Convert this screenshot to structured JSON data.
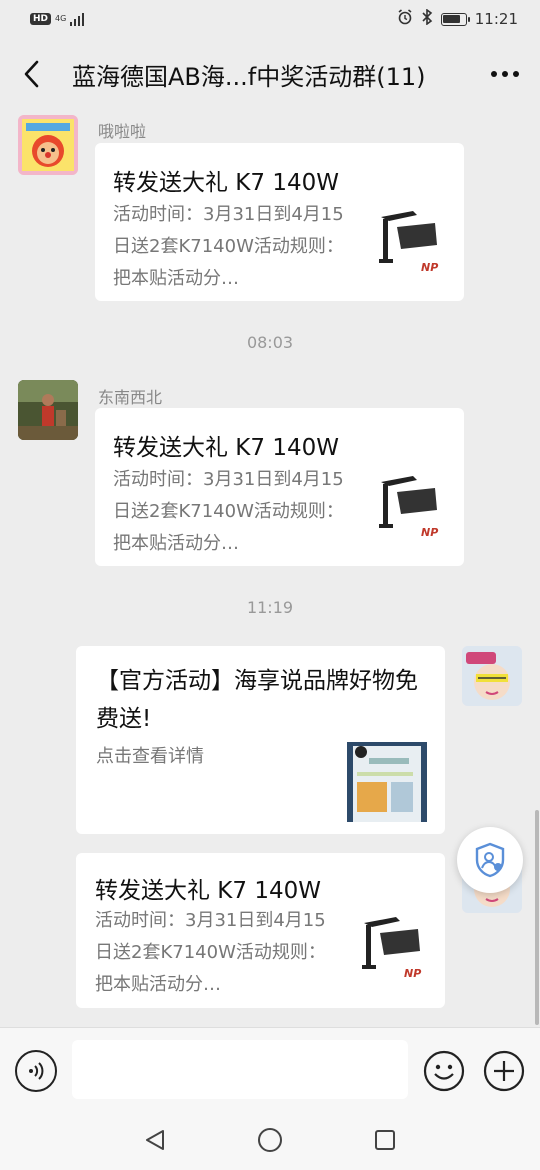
{
  "status_bar": {
    "hd": "HD",
    "network": "4G",
    "time": "11:21",
    "battery_level": 0.8
  },
  "header": {
    "title": "蓝海德国AB海...f中奖活动群(11)"
  },
  "messages": [
    {
      "sender": "哦啦啦",
      "title": "转发送大礼 K7 140W",
      "desc": "活动时间：3月31日到4月15日送2套K7140W活动规则：把本贴活动分…",
      "thumb_label": "NP"
    },
    {
      "sender": "东南西北",
      "title": "转发送大礼 K7 140W",
      "desc": "活动时间：3月31日到4月15日送2套K7140W活动规则：把本贴活动分…",
      "thumb_label": "NP"
    },
    {
      "title": "【官方活动】海享说品牌好物免费送!",
      "desc": "点击查看详情"
    },
    {
      "title": "转发送大礼 K7 140W",
      "desc": "活动时间：3月31日到4月15日送2套K7140W活动规则：把本贴活动分…",
      "thumb_label": "NP"
    }
  ],
  "timestamps": [
    "08:03",
    "11:19"
  ],
  "input": {
    "placeholder": ""
  },
  "colors": {
    "background": "#ededed",
    "bubble": "#ffffff",
    "accent_blue": "#5a8fd8"
  }
}
